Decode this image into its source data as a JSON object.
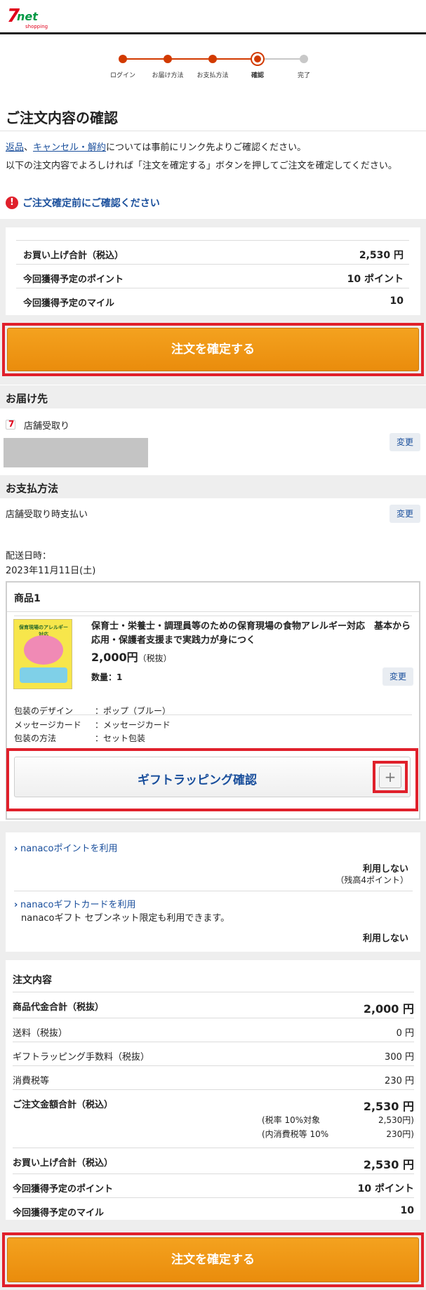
{
  "header": {
    "logo_main": "7net",
    "logo_net": "net",
    "logo_sub": "shopping"
  },
  "steps": [
    {
      "label": "ログイン",
      "state": "done"
    },
    {
      "label": "お届け方法",
      "state": "done"
    },
    {
      "label": "お支払方法",
      "state": "done"
    },
    {
      "label": "確認",
      "state": "current"
    },
    {
      "label": "完了",
      "state": "todo"
    }
  ],
  "colors": {
    "accent": "#d23a00",
    "button": "#f09618",
    "link": "#1a4f9c",
    "alert": "#e0202b"
  },
  "page_title": "ご注文内容の確認",
  "intro": {
    "link_return": "返品",
    "separator": "、",
    "link_cancel": "キャンセル・解約",
    "line1_rest": "については事前にリンク先よりご確認ください。",
    "line2": "以下の注文内容でよろしければ「注文を確定する」ボタンを押してご注文を確定してください。"
  },
  "warning": {
    "icon": "exclamation-icon",
    "glyph": "!",
    "text": "ご注文確定前にご確認ください"
  },
  "summary_top": [
    {
      "label": "お買い上げ合計（税込）",
      "value": "2,530 円"
    },
    {
      "label": "今回獲得予定のポイント",
      "value": "10 ポイント"
    },
    {
      "label": "今回獲得予定のマイル",
      "value": "10"
    }
  ],
  "confirm_button": "注文を確定する",
  "delivery": {
    "heading": "お届け先",
    "method": "店舗受取り",
    "change": "変更"
  },
  "payment": {
    "heading": "お支払方法",
    "method": "店舗受取り時支払い",
    "change": "変更"
  },
  "delivery_date": {
    "label": "配送日時：",
    "value": "2023年11月11日(土)"
  },
  "product": {
    "heading": "商品1",
    "cover_text": "保育現場のアレルギー対応",
    "title": "保育士・栄養士・調理員等のための保育現場の食物アレルギー対応　基本から応用・保護者支援まで実践力が身につく",
    "price": "2,000円",
    "price_note": "（税抜）",
    "quantity": "数量：1",
    "change": "変更",
    "packaging": [
      {
        "label": "包装のデザイン",
        "value": "：ポップ（ブルー）"
      },
      {
        "label": "メッセージカード",
        "value": "：メッセージカード"
      },
      {
        "label": "包装の方法",
        "value": "：セット包装"
      }
    ],
    "gift_button": "ギフトラッピング確認",
    "plus": "+"
  },
  "nanaco": {
    "points_link": "nanacoポイントを利用",
    "points_value": "利用しない",
    "points_balance": "（残高4ポイント）",
    "gift_link": "nanacoギフトカードを利用",
    "gift_note": "nanacoギフト セブンネット限定も利用できます。",
    "gift_value": "利用しない"
  },
  "order_detail": {
    "heading": "注文内容",
    "rows": [
      {
        "label": "商品代金合計（税抜）",
        "value": "2,000 円"
      },
      {
        "label": "送料（税抜）",
        "value": "0 円"
      },
      {
        "label": "ギフトラッピング手数料（税抜）",
        "value": "300 円"
      },
      {
        "label": "消費税等",
        "value": "230 円"
      }
    ],
    "total_label": "ご注文金額合計（税込）",
    "total_value": "2,530 円",
    "tax_rate_label": "(税率 10%対象",
    "tax_rate_value": "2,530円)",
    "tax_incl_label": "(内消費税等 10%",
    "tax_incl_value": "230円)",
    "purchase_label": "お買い上げ合計（税込）",
    "purchase_value": "2,530 円",
    "points_label": "今回獲得予定のポイント",
    "points_value": "10 ポイント",
    "miles_label": "今回獲得予定のマイル",
    "miles_value": "10"
  }
}
